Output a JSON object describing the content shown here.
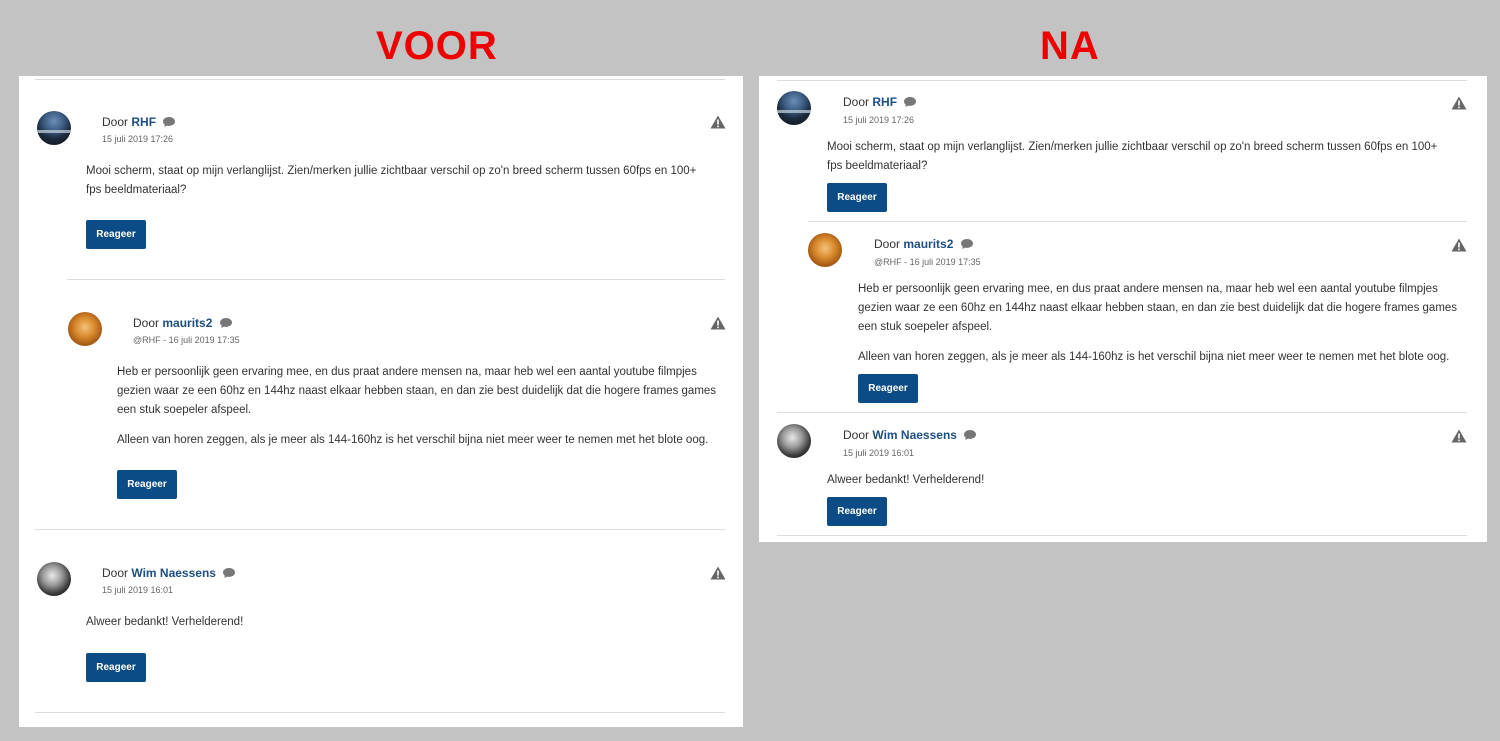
{
  "labels": {
    "before": "VOOR",
    "after": "NA"
  },
  "by_prefix": "Door",
  "reply_label": "Reageer",
  "colors": {
    "author_link": "#1d4f84",
    "button": "#0c4c86",
    "label": "#ee0000",
    "background": "#c3c3c3"
  },
  "icons": {
    "author": "speech-bubble-icon",
    "report": "warning-triangle-icon"
  },
  "comments": [
    {
      "author": "RHF",
      "date": "15 juli 2019 17:26",
      "paragraphs": [
        "Mooi scherm, staat op mijn verlanglijst. Zien/merken jullie zichtbaar verschil op zo'n breed scherm tussen 60fps en 100+ fps beeldmateriaal?"
      ]
    },
    {
      "author": "maurits2",
      "date": "@RHF - 16 juli 2019 17:35",
      "paragraphs": [
        "Heb er persoonlijk geen ervaring mee, en dus praat andere mensen na, maar heb wel een aantal youtube filmpjes gezien waar ze een 60hz en 144hz naast elkaar hebben staan, en dan zie best duidelijk dat die hogere frames games een stuk soepeler afspeel.",
        "Alleen van horen zeggen, als je meer als 144-160hz is het verschil bijna niet meer weer te nemen met het blote oog."
      ]
    },
    {
      "author": "Wim Naessens",
      "date": "15 juli 2019 16:01",
      "paragraphs": [
        "Alweer bedankt! Verhelderend!"
      ]
    }
  ]
}
